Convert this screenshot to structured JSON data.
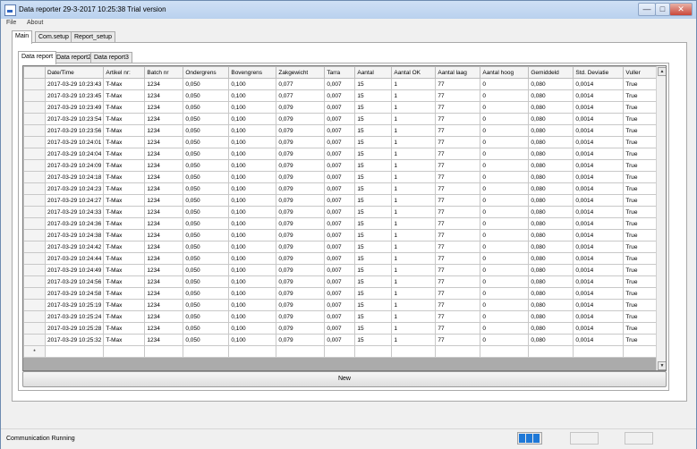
{
  "window": {
    "title": "Data reporter 29-3-2017 10:25:38 Trial version",
    "controls": {
      "minimize": "—",
      "maximize": "□",
      "close": "✕"
    }
  },
  "menu": {
    "file": "File",
    "about": "About"
  },
  "tabs": {
    "main": "Main",
    "com_setup": "Com.setup",
    "report_setup": "Report_setup"
  },
  "subtabs": {
    "r1": "Data report",
    "r2": "Data report2",
    "r3": "Data report3"
  },
  "table": {
    "columns": [
      "Date/Time",
      "Artikel nr:",
      "Batch nr",
      "Ondergrens",
      "Bovengrens",
      "Zakgewicht",
      "Tarra",
      "Aantal",
      "Aantal OK",
      "Aantal laag",
      "Aantal hoog",
      "Gemiddeld",
      "Std. Deviatie",
      "Vuller"
    ],
    "rows": [
      [
        "2017-03-29 10:23:43",
        "T-Max",
        "1234",
        "0,050",
        "0,100",
        "0,077",
        "0,007",
        "15",
        "1",
        "77",
        "0",
        "0,080",
        "0,0014",
        "True"
      ],
      [
        "2017-03-29 10:23:45",
        "T-Max",
        "1234",
        "0,050",
        "0,100",
        "0,077",
        "0,007",
        "15",
        "1",
        "77",
        "0",
        "0,080",
        "0,0014",
        "True"
      ],
      [
        "2017-03-29 10:23:49",
        "T-Max",
        "1234",
        "0,050",
        "0,100",
        "0,079",
        "0,007",
        "15",
        "1",
        "77",
        "0",
        "0,080",
        "0,0014",
        "True"
      ],
      [
        "2017-03-29 10:23:54",
        "T-Max",
        "1234",
        "0,050",
        "0,100",
        "0,079",
        "0,007",
        "15",
        "1",
        "77",
        "0",
        "0,080",
        "0,0014",
        "True"
      ],
      [
        "2017-03-29 10:23:56",
        "T-Max",
        "1234",
        "0,050",
        "0,100",
        "0,079",
        "0,007",
        "15",
        "1",
        "77",
        "0",
        "0,080",
        "0,0014",
        "True"
      ],
      [
        "2017-03-29 10:24:01",
        "T-Max",
        "1234",
        "0,050",
        "0,100",
        "0,079",
        "0,007",
        "15",
        "1",
        "77",
        "0",
        "0,080",
        "0,0014",
        "True"
      ],
      [
        "2017-03-29 10:24:04",
        "T-Max",
        "1234",
        "0,050",
        "0,100",
        "0,079",
        "0,007",
        "15",
        "1",
        "77",
        "0",
        "0,080",
        "0,0014",
        "True"
      ],
      [
        "2017-03-29 10:24:09",
        "T-Max",
        "1234",
        "0,050",
        "0,100",
        "0,079",
        "0,007",
        "15",
        "1",
        "77",
        "0",
        "0,080",
        "0,0014",
        "True"
      ],
      [
        "2017-03-29 10:24:18",
        "T-Max",
        "1234",
        "0,050",
        "0,100",
        "0,079",
        "0,007",
        "15",
        "1",
        "77",
        "0",
        "0,080",
        "0,0014",
        "True"
      ],
      [
        "2017-03-29 10:24:23",
        "T-Max",
        "1234",
        "0,050",
        "0,100",
        "0,079",
        "0,007",
        "15",
        "1",
        "77",
        "0",
        "0,080",
        "0,0014",
        "True"
      ],
      [
        "2017-03-29 10:24:27",
        "T-Max",
        "1234",
        "0,050",
        "0,100",
        "0,079",
        "0,007",
        "15",
        "1",
        "77",
        "0",
        "0,080",
        "0,0014",
        "True"
      ],
      [
        "2017-03-29 10:24:33",
        "T-Max",
        "1234",
        "0,050",
        "0,100",
        "0,079",
        "0,007",
        "15",
        "1",
        "77",
        "0",
        "0,080",
        "0,0014",
        "True"
      ],
      [
        "2017-03-29 10:24:36",
        "T-Max",
        "1234",
        "0,050",
        "0,100",
        "0,079",
        "0,007",
        "15",
        "1",
        "77",
        "0",
        "0,080",
        "0,0014",
        "True"
      ],
      [
        "2017-03-29 10:24:38",
        "T-Max",
        "1234",
        "0,050",
        "0,100",
        "0,079",
        "0,007",
        "15",
        "1",
        "77",
        "0",
        "0,080",
        "0,0014",
        "True"
      ],
      [
        "2017-03-29 10:24:42",
        "T-Max",
        "1234",
        "0,050",
        "0,100",
        "0,079",
        "0,007",
        "15",
        "1",
        "77",
        "0",
        "0,080",
        "0,0014",
        "True"
      ],
      [
        "2017-03-29 10:24:44",
        "T-Max",
        "1234",
        "0,050",
        "0,100",
        "0,079",
        "0,007",
        "15",
        "1",
        "77",
        "0",
        "0,080",
        "0,0014",
        "True"
      ],
      [
        "2017-03-29 10:24:49",
        "T-Max",
        "1234",
        "0,050",
        "0,100",
        "0,079",
        "0,007",
        "15",
        "1",
        "77",
        "0",
        "0,080",
        "0,0014",
        "True"
      ],
      [
        "2017-03-29 10:24:56",
        "T-Max",
        "1234",
        "0,050",
        "0,100",
        "0,079",
        "0,007",
        "15",
        "1",
        "77",
        "0",
        "0,080",
        "0,0014",
        "True"
      ],
      [
        "2017-03-29 10:24:58",
        "T-Max",
        "1234",
        "0,050",
        "0,100",
        "0,079",
        "0,007",
        "15",
        "1",
        "77",
        "0",
        "0,080",
        "0,0014",
        "True"
      ],
      [
        "2017-03-29 10:25:19",
        "T-Max",
        "1234",
        "0,050",
        "0,100",
        "0,079",
        "0,007",
        "15",
        "1",
        "77",
        "0",
        "0,080",
        "0,0014",
        "True"
      ],
      [
        "2017-03-29 10:25:24",
        "T-Max",
        "1234",
        "0,050",
        "0,100",
        "0,079",
        "0,007",
        "15",
        "1",
        "77",
        "0",
        "0,080",
        "0,0014",
        "True"
      ],
      [
        "2017-03-29 10:25:28",
        "T-Max",
        "1234",
        "0,050",
        "0,100",
        "0,079",
        "0,007",
        "15",
        "1",
        "77",
        "0",
        "0,080",
        "0,0014",
        "True"
      ],
      [
        "2017-03-29 10:25:32",
        "T-Max",
        "1234",
        "0,050",
        "0,100",
        "0,079",
        "0,007",
        "15",
        "1",
        "77",
        "0",
        "0,080",
        "0,0014",
        "True"
      ]
    ],
    "new_row_marker": "*"
  },
  "new_button": "New",
  "status": {
    "text": "Communication Running",
    "progress_segments": 3
  },
  "colors": {
    "titlebar": "#c4d8f0",
    "progress": "#1e78d7",
    "grid_background": "#ababab"
  }
}
